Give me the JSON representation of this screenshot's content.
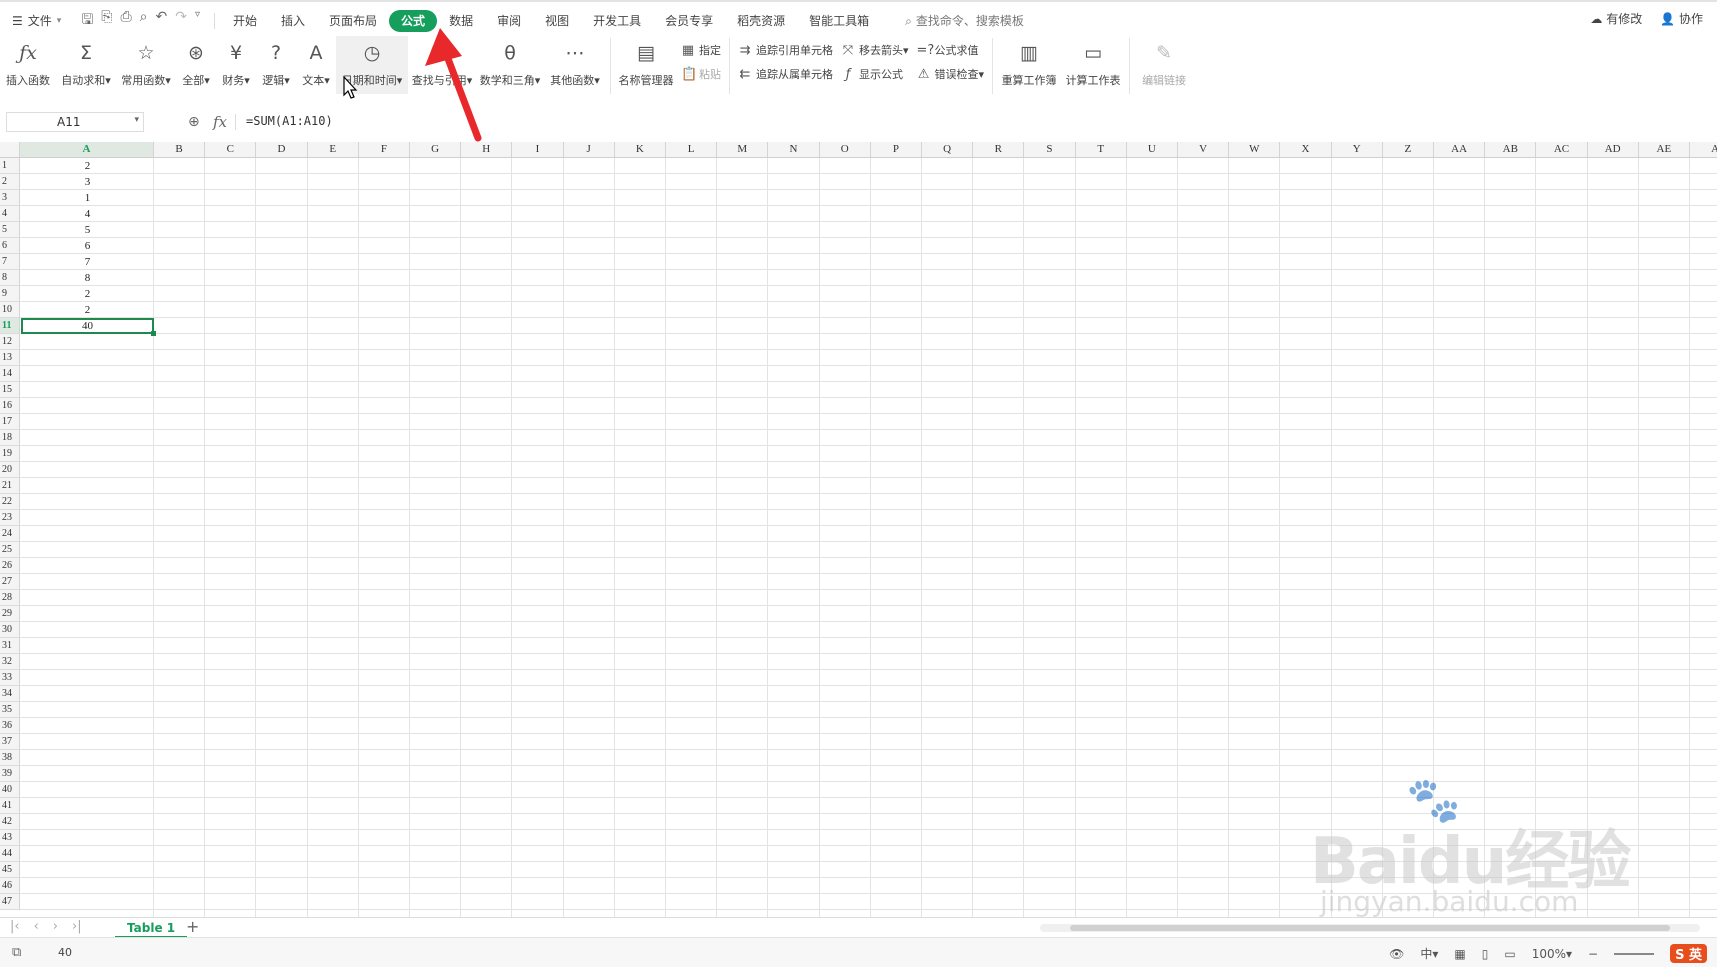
{
  "menu": {
    "file_label": "文件",
    "tabs": [
      "开始",
      "插入",
      "页面布局",
      "公式",
      "数据",
      "审阅",
      "视图",
      "开发工具",
      "会员专享",
      "稻壳资源",
      "智能工具箱"
    ],
    "active_tab": "公式",
    "search_text": "查找命令、搜索模板",
    "right": {
      "changes": "有修改",
      "collab": "协作"
    }
  },
  "ribbon": {
    "buttons": [
      {
        "label": "插入函数",
        "icon": "fx-icon"
      },
      {
        "label": "自动求和",
        "icon": "sigma-icon"
      },
      {
        "label": "常用函数",
        "icon": "star-icon"
      },
      {
        "label": "全部",
        "icon": "asterisk-icon"
      },
      {
        "label": "财务",
        "icon": "yen-icon"
      },
      {
        "label": "逻辑",
        "icon": "question-icon"
      },
      {
        "label": "文本",
        "icon": "text-a-icon"
      },
      {
        "label": "日期和时间",
        "icon": "clock-icon"
      },
      {
        "label": "查找与引用",
        "icon": "magnifier-icon"
      },
      {
        "label": "数学和三角",
        "icon": "theta-icon"
      },
      {
        "label": "其他函数",
        "icon": "more-icon"
      },
      {
        "label": "名称管理器",
        "icon": "name-manager-icon"
      }
    ],
    "stack1": [
      {
        "label": "指定",
        "icon": "grid-icon"
      },
      {
        "label": "粘贴",
        "icon": "paste-icon"
      }
    ],
    "stack2": [
      {
        "label": "追踪引用单元格",
        "icon": "trace-precedents-icon"
      },
      {
        "label": "追踪从属单元格",
        "icon": "trace-dependents-icon"
      }
    ],
    "stack3": [
      {
        "label": "移去箭头",
        "icon": "remove-arrows-icon"
      },
      {
        "label": "显示公式",
        "icon": "show-formula-icon"
      }
    ],
    "stack4": [
      {
        "label": "公式求值",
        "icon": "evaluate-icon"
      },
      {
        "label": "错误检查",
        "icon": "warning-icon"
      }
    ],
    "calc_buttons": [
      {
        "label": "重算工作簿",
        "icon": "recalc-icon"
      },
      {
        "label": "计算工作表",
        "icon": "calc-sheet-icon"
      },
      {
        "label": "编辑链接",
        "icon": "edit-link-icon"
      }
    ]
  },
  "formula_bar": {
    "cell_ref": "A11",
    "formula": "=SUM(A1:A10)"
  },
  "sheet": {
    "columns": [
      "A",
      "B",
      "C",
      "D",
      "E",
      "F",
      "G",
      "H",
      "I",
      "J",
      "K",
      "L",
      "M",
      "N",
      "O",
      "P",
      "Q",
      "R",
      "S",
      "T",
      "U",
      "V",
      "W",
      "X",
      "Y",
      "Z",
      "AA",
      "AB",
      "AC",
      "AD",
      "AE",
      "A"
    ],
    "row_count": 47,
    "values_A": [
      "2",
      "3",
      "1",
      "4",
      "5",
      "6",
      "7",
      "8",
      "2",
      "2",
      "40"
    ],
    "selected_row": 11
  },
  "tabs": {
    "sheet_name": "Table 1"
  },
  "status": {
    "value": "40",
    "zoom": "100%",
    "ime": "英"
  },
  "watermark": {
    "brand": "Baidu经验",
    "url": "jingyan.baidu.com"
  },
  "colors": {
    "accent": "#169e5c",
    "arrow": "#e8282b"
  }
}
